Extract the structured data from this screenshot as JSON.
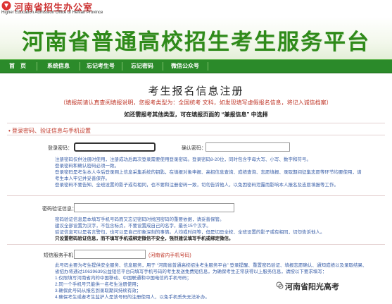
{
  "header": {
    "org_name_cn": "河南省招生办公室",
    "org_name_en": "Higher Education Admission Office of HeNan Province",
    "banner_title": "河南省普通高校招生考生服务平台"
  },
  "nav": {
    "items": [
      "首　页",
      "系统信息",
      "忘记考生号",
      "忘记密码",
      "微信公众号"
    ]
  },
  "form": {
    "page_title": "考生报名信息注册",
    "notice": "（填报前请认真查阅填报说明，您报考类型为：全国统考 文科，如发现填写虚假报名信息，将记入诚信档案）",
    "type_choice": "如还需报考其他类型，可在填报页面的 “兼报信息” 中选择",
    "section_login": "登录密码、验证信息与手机设置",
    "password_label": "登录密码：",
    "confirm_label": "确认密码：",
    "password_help": [
      "注册密码仅供注册时使用，注册成功后再次登录需要使用登录密码。登录密码8-20位，同时包含字母大写、小写、数字和符号。",
      "登录密码和确认密码必须一致。",
      "登录密码是考生本人今后登录网上信息采集系统的钥匙，在填报对象申报、高招信息查询、成绩查询、志愿填报、录取期间征集志愿等环节均要使用，请",
      "考生本人牢记并妥善保存。",
      "登录密码不要告知、全班设置的影子或有相同，也不要和注册密码一致，切勿告诉他人，以免因密码泄露而影响本人报名及志愿填报等工作。"
    ],
    "verify_label": "密码验证信息：",
    "verify_help": [
      "密码验证信息是本填写手机号码而又忘记密码时找回密码的重要依据，请妥善保管。",
      "建议全部设置为汉字，不包含标点，不要设置成自己的名字，最长15个汉字。",
      "验证信息可以是名言警句，也可以是自己印象深刻的事情。人均或时间等，但是切忌全校、全班设置的影子或有相同，切勿告诉他人。",
      "只设置密码验证信息，而不填写手机或绑定微信不安全，强烈建议填写手机或绑定微信。"
    ],
    "phone_label": "短信服务手机：",
    "phone_hint": "(河南省内手机号码)",
    "phone_help": [
      "此号码主要为考生提供安全服务、信息服务，用于 “河南省普通高校招生考生服务平台” 登录提醒、重置密码验证、填报志愿确认、通知成绩以及录取结果、",
      "省招办将通过10639639公益短信平台向填写手机号码的考生发送免费短信息，为确保考生正常获得以上服务信息，请按以下要求填写：",
      "1.仅限填写河南省内的中国移动、中国联通和中国电信的手机号码；",
      "2.同一个手机号只能供一名考生注册使用；",
      "3.确保此号码从报名到录取期间持续有效；",
      "4.确保考生或者考生监护人是该号码的注册使用人，以免手机丢失无法补办。"
    ]
  },
  "watermark": {
    "text": "河南省阳光高考"
  },
  "colors": {
    "brand_green": "#2f8a1a",
    "nav_green": "#2b8a2a",
    "notice_red": "#c0392b",
    "help_blue": "#3a5fa8"
  }
}
